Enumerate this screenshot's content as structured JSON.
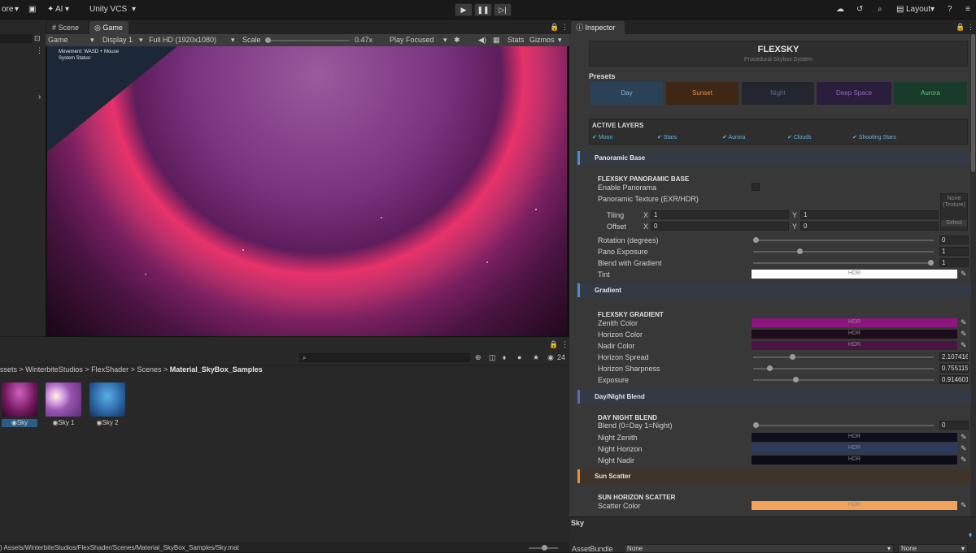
{
  "menubar": {
    "file_menu": "ore",
    "ai_label": "AI",
    "vcs_label": "Unity VCS",
    "layout_label": "Layout"
  },
  "scene_tabs": {
    "scene": "Scene",
    "game": "Game"
  },
  "game_toolbar": {
    "mode": "Game",
    "display": "Display 1",
    "resolution": "Full HD (1920x1080)",
    "scale_label": "Scale",
    "scale_value": "0.47x",
    "play_mode": "Play Focused",
    "stats": "Stats",
    "gizmos": "Gizmos"
  },
  "game_overlay": {
    "line1": "Movement: WASD + Mouse",
    "line2": "System Status:"
  },
  "project": {
    "visible_count": "24",
    "breadcrumb": [
      "ssets",
      "WinterbiteStudios",
      "FlexShader",
      "Scenes",
      "Material_SkyBox_Samples"
    ],
    "assets": [
      {
        "name": "Sky",
        "selected": true
      },
      {
        "name": "Sky 1",
        "selected": false
      },
      {
        "name": "Sky 2",
        "selected": false
      }
    ],
    "status_path": ") Assets/WinterbiteStudios/FlexShader/Scenes/Material_SkyBox_Samples/Sky.mat"
  },
  "inspector": {
    "tab": "Inspector",
    "banner_title": "FLEXSKY",
    "banner_subtitle": "Procedural Skybox System",
    "presets_label": "Presets",
    "presets": [
      {
        "name": "Day",
        "bg": "#2b4156",
        "fg": "#7fb3dc"
      },
      {
        "name": "Sunset",
        "bg": "#3f2715",
        "fg": "#e4904a"
      },
      {
        "name": "Night",
        "bg": "#23262f",
        "fg": "#5a6a88"
      },
      {
        "name": "Deep Space",
        "bg": "#2b1d3c",
        "fg": "#8c6ab8"
      },
      {
        "name": "Aurora",
        "bg": "#1a3a2a",
        "fg": "#5bc490"
      }
    ],
    "active_layers_label": "ACTIVE LAYERS",
    "layers": [
      "Moon",
      "Stars",
      "Aurora",
      "Clouds",
      "Shooting Stars"
    ],
    "panoramic": {
      "section": "Panoramic Base",
      "header": "FLEXSKY PANORAMIC BASE",
      "enable": "Enable Panorama",
      "texture": "Panoramic Texture (EXR/HDR)",
      "texture_slot": "None (Texture)",
      "select": "Select",
      "tiling": "Tiling",
      "offset": "Offset",
      "x": "X",
      "y": "Y",
      "tiling_x": "1",
      "tiling_y": "1",
      "offset_x": "0",
      "offset_y": "0",
      "rotation_label": "Rotation (degrees)",
      "rotation": "0",
      "rotation_fill": 0,
      "exposure_label": "Pano Exposure",
      "exposure": "1",
      "exposure_fill": 0.25,
      "blend_label": "Blend with Gradient",
      "blend": "1",
      "blend_fill": 1,
      "tint_label": "Tint",
      "tint_color": "#ffffff"
    },
    "gradient": {
      "section": "Gradient",
      "header": "FLEXSKY GRADIENT",
      "zenith_label": "Zenith Color",
      "zenith_color": "#8e1580",
      "horizon_label": "Horizon Color",
      "horizon_color": "#1c0b1a",
      "nadir_label": "Nadir Color",
      "nadir_color": "#4a1442",
      "spread_label": "Horizon Spread",
      "spread": "2.107416",
      "spread_fill": 0.21,
      "sharp_label": "Horizon Sharpness",
      "sharp": "0.755115",
      "sharp_fill": 0.08,
      "exposure_label": "Exposure",
      "exposure": "0.914601",
      "exposure_fill": 0.23
    },
    "daynight": {
      "section": "Day/Night Blend",
      "header": "DAY NIGHT BLEND",
      "blend_label": "Blend (0=Day  1=Night)",
      "blend": "0",
      "blend_fill": 0,
      "zenith_label": "Night Zenith",
      "zenith_color": "#0d0f1e",
      "horizon_label": "Night Horizon",
      "horizon_color": "#2c3a5e",
      "nadir_label": "Night Nadir",
      "nadir_color": "#0b0c16"
    },
    "sun": {
      "section": "Sun Scatter",
      "header": "SUN HORIZON SCATTER",
      "color_label": "Scatter Color",
      "color": "#f0a35a"
    },
    "hdr": "HDR",
    "asset_name": "Sky",
    "assetbundle_label": "AssetBundle",
    "assetbundle": "None",
    "variant": "None"
  }
}
